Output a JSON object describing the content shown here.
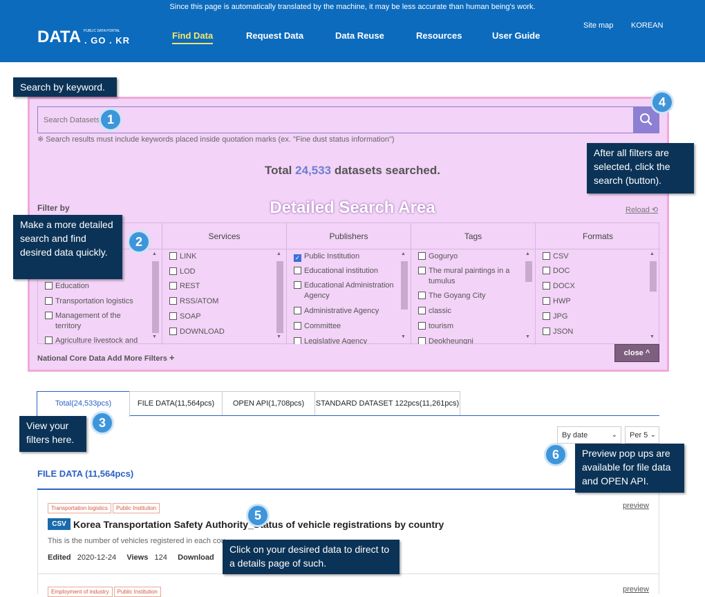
{
  "header": {
    "notice": "Since this page is automatically translated by the machine, it may be less accurate than human being's work.",
    "logo_main": "DATA",
    "logo_small": "PUBLIC DATA PORTAL",
    "logo_domain": ". GO . KR",
    "nav": [
      "Find Data",
      "Request Data",
      "Data Reuse",
      "Resources",
      "User Guide"
    ],
    "util": [
      "Site map",
      "KOREAN"
    ]
  },
  "search": {
    "placeholder": "Search Datasets",
    "note": "※ Search results must include keywords placed inside quotation marks (ex. \"Fine dust status information\")",
    "total_prefix": "Total ",
    "total_count": "24,533",
    "total_suffix": " datasets searched."
  },
  "detailed_area_label": "Detailed Search Area",
  "filter": {
    "title": "Filter by",
    "reload": "Reload",
    "columns": [
      {
        "header": "",
        "options": [
          "",
          "",
          "Education",
          "Transportation logistics",
          "Management of the territory",
          "Agriculture livestock and"
        ]
      },
      {
        "header": "Services",
        "options": [
          "LINK",
          "LOD",
          "REST",
          "RSS/ATOM",
          "SOAP",
          "DOWNLOAD"
        ]
      },
      {
        "header": "Publishers",
        "options": [
          "Public Institution",
          "Educational institution",
          "Educational Administration Agency",
          "Administrative Agency",
          "Committee",
          "Legislative Agency"
        ]
      },
      {
        "header": "Tags",
        "options": [
          "Goguryo",
          "The mural paintings in a tumulus",
          "The Goyang City",
          "classic",
          "tourism",
          "Deokheungni"
        ]
      },
      {
        "header": "Formats",
        "options": [
          "CSV",
          "DOC",
          "DOCX",
          "HWP",
          "JPG",
          "JSON"
        ]
      }
    ],
    "more": "National Core Data Add More Filters",
    "close": "close"
  },
  "tabs": [
    "Total(24,533pcs)",
    "FILE DATA(11,564pcs)",
    "OPEN API(1,708pcs)",
    "STANDARD DATASET 122pcs(11,261pcs)"
  ],
  "sort": {
    "selected": "By date",
    "per": "Per 5"
  },
  "results": {
    "section_title": "FILE DATA (11,564pcs)",
    "items": [
      {
        "tags": [
          "Transportation logistics",
          "Public Institution"
        ],
        "format": "CSV",
        "title": "Korea Transportation Safety Authority_Status of vehicle registrations by country",
        "desc": "This is the number of vehicles registered in each cou",
        "edited_label": "Edited",
        "edited": "2020-12-24",
        "views_label": "Views",
        "views": "124",
        "download_label": "Download",
        "preview": "preview"
      },
      {
        "tags": [
          "Employment of industry",
          "Public Institution"
        ],
        "preview": "preview"
      }
    ]
  },
  "callouts": [
    {
      "num": "1",
      "text": "Search by keyword."
    },
    {
      "num": "2",
      "text": "Make a more detailed search and find desired data quickly."
    },
    {
      "num": "3",
      "text": "View your filters here."
    },
    {
      "num": "4",
      "text": "After all filters are selected, click the search (button)."
    },
    {
      "num": "5",
      "text": "Click on your desired data to direct to a details page of such."
    },
    {
      "num": "6",
      "text": "Preview pop ups are available for file data and OPEN API."
    }
  ]
}
